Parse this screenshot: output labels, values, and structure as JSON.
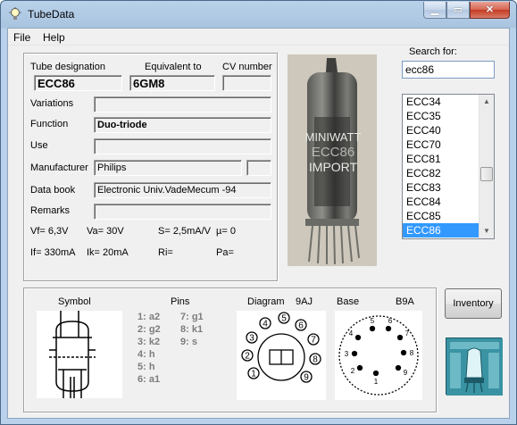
{
  "window": {
    "title": "TubeData"
  },
  "menu": {
    "file": "File",
    "help": "Help"
  },
  "labels": {
    "tube_designation": "Tube designation",
    "equivalent_to": "Equivalent to",
    "cv_number": "CV number",
    "variations": "Variations",
    "function": "Function",
    "use": "Use",
    "manufacturer": "Manufacturer",
    "data_book": "Data book",
    "remarks": "Remarks"
  },
  "fields": {
    "tube_designation": "ECC86",
    "equivalent_to": "6GM8",
    "cv_number": "",
    "variations": "",
    "function": "Duo-triode",
    "use": "",
    "manufacturer": "Philips",
    "manufacturer_extra": "",
    "data_book": "Electronic Univ.VadeMecum -94",
    "remarks": ""
  },
  "specs": {
    "vf": "Vf= 6,3V",
    "va": "Va=  30V",
    "s": "S= 2,5mA/V",
    "mu": "µ=    0",
    "if": "If= 330mA",
    "ik": "Ik=   20mA",
    "ri": "Ri=",
    "pa": "Pa="
  },
  "photo": {
    "print_line1": "MINIWATT",
    "print_line2": "ECC86",
    "print_line3": "IMPORT"
  },
  "search": {
    "label": "Search for:",
    "value": "ecc86"
  },
  "tube_list": {
    "items": [
      "ECC34",
      "ECC35",
      "ECC40",
      "ECC70",
      "ECC81",
      "ECC82",
      "ECC83",
      "ECC84",
      "ECC85",
      "ECC86"
    ],
    "selected": "ECC86"
  },
  "bottom": {
    "symbol_label": "Symbol",
    "pins_label": "Pins",
    "diagram_label": "Diagram",
    "diagram_code": "9AJ",
    "base_label": "Base",
    "base_code": "B9A",
    "pins_col1": [
      "1: a2",
      "2: g2",
      "3: k2",
      "4: h",
      "5: h",
      "6: a1"
    ],
    "pins_col2": [
      "7: g1",
      "8: k1",
      "9: s"
    ],
    "diagram_pin_numbers": [
      "1",
      "2",
      "3",
      "4",
      "5",
      "6",
      "7",
      "8",
      "9"
    ],
    "base_numbers": [
      "1",
      "2",
      "3",
      "4",
      "5",
      "6",
      "7",
      "8",
      "9"
    ]
  },
  "buttons": {
    "inventory": "Inventory"
  },
  "colors": {
    "selection": "#3399ff",
    "titlebar": "#b9d1ea",
    "close": "#c63b24"
  }
}
